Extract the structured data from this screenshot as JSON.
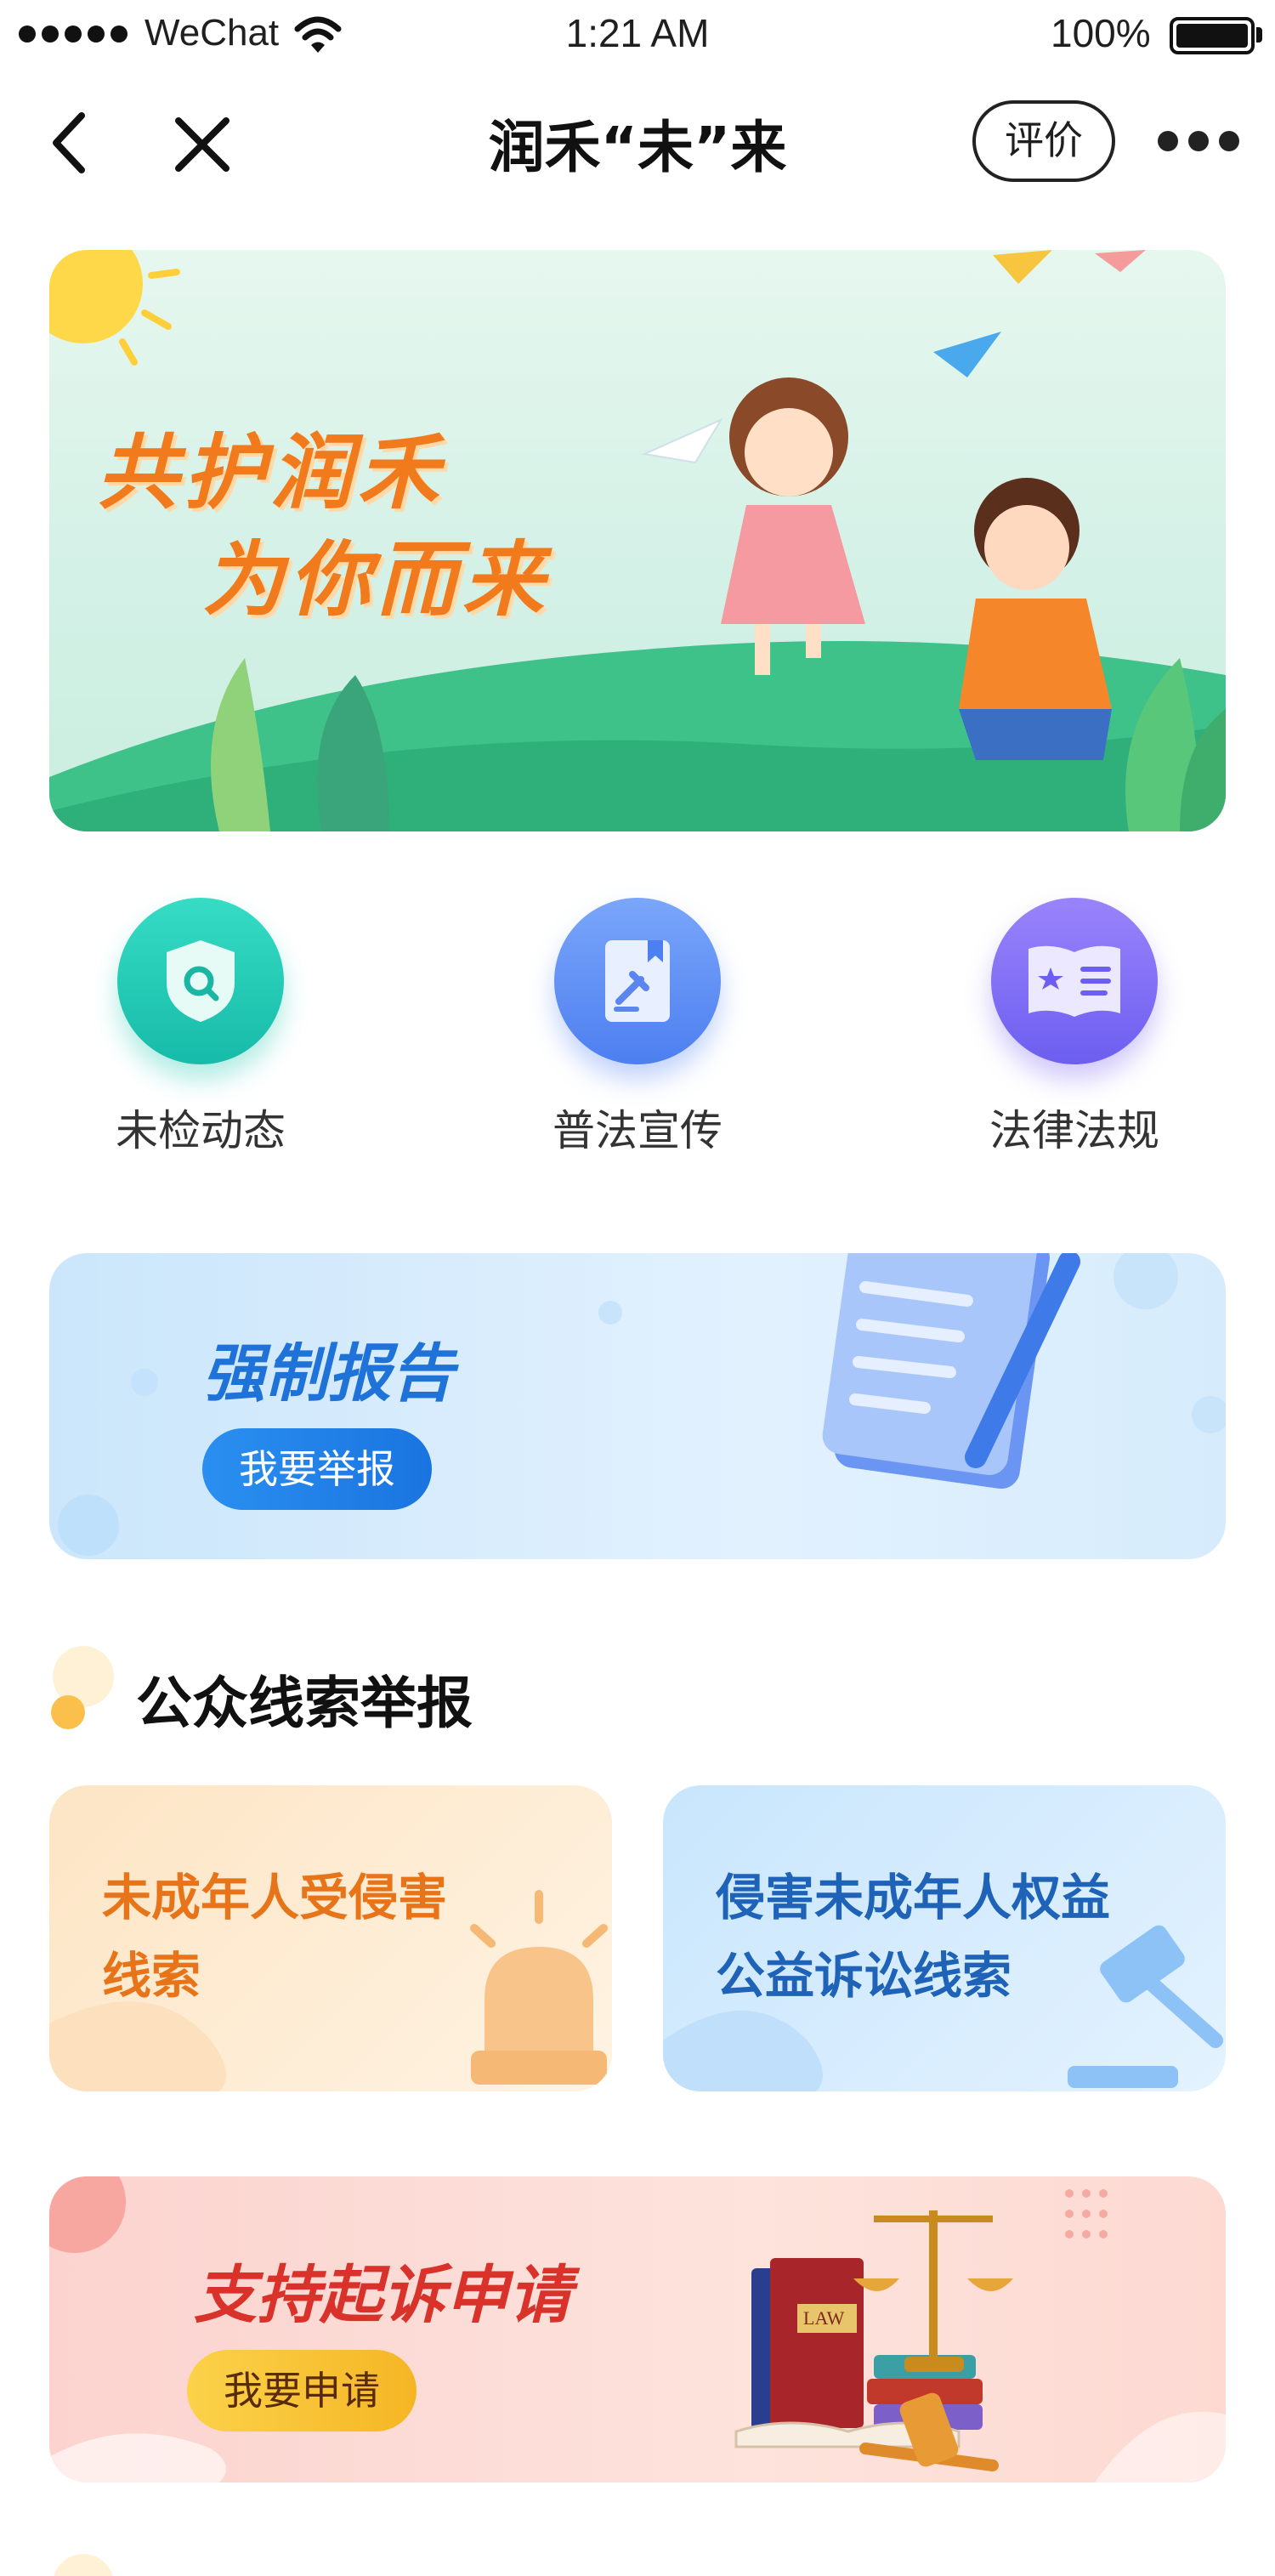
{
  "status_bar": {
    "carrier": "WeChat",
    "time": "1:21 AM",
    "battery": "100%"
  },
  "nav": {
    "title": "润禾“未”来",
    "rate_label": "评价"
  },
  "hero": {
    "line1": "共护润禾",
    "line2": "为你而来"
  },
  "quick_links": [
    {
      "label": "未检动态",
      "icon": "shield-search-icon",
      "color": "#22cbb6"
    },
    {
      "label": "普法宣传",
      "icon": "law-book-icon",
      "color": "#5a8df5"
    },
    {
      "label": "法律法规",
      "icon": "open-book-star-icon",
      "color": "#7a6cf3"
    }
  ],
  "report": {
    "title": "强制报告",
    "button": "我要举报"
  },
  "public_clues": {
    "title": "公众线索举报",
    "cards": [
      {
        "line1": "未成年人受侵害",
        "line2": "线索",
        "color": "#e8741a"
      },
      {
        "line1": "侵害未成年人权益",
        "line2": "公益诉讼线索",
        "color": "#1e63b8"
      }
    ]
  },
  "support": {
    "title": "支持起诉申请",
    "button": "我要申请",
    "book_label": "LAW"
  }
}
